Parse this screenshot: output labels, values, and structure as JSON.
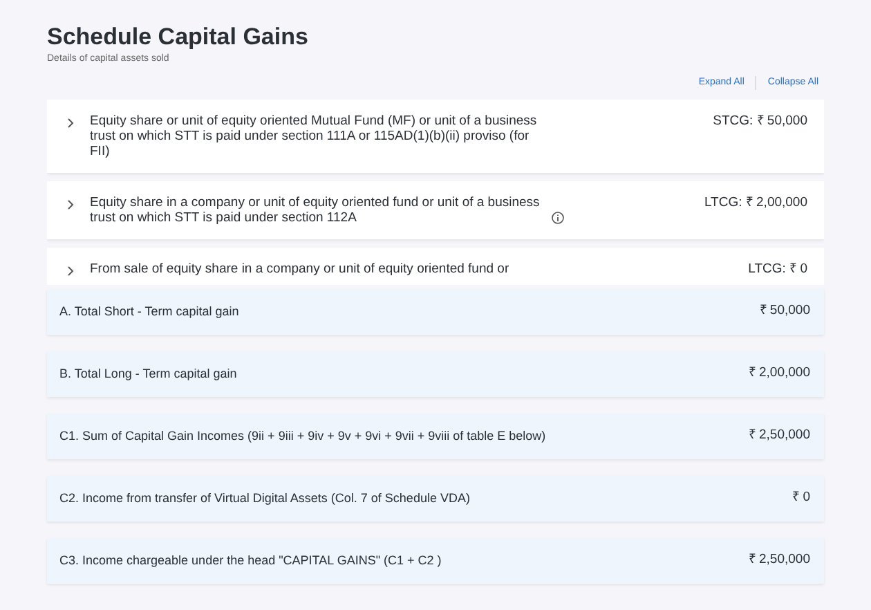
{
  "header": {
    "title": "Schedule Capital Gains",
    "subtitle": "Details of capital assets sold"
  },
  "actions": [
    "Expand All",
    "Collapse All"
  ],
  "sections": [
    {
      "expanded": false,
      "label": "Equity share or unit of equity oriented Mutual Fund (MF) or unit of a business trust on which STT is paid under section 111A or 115AD(1)(b)(ii) proviso (for FII)",
      "info": false,
      "amount_label": "STCG:",
      "amount": "₹ 50,000"
    },
    {
      "expanded": false,
      "label": "Equity share in a company or unit of equity oriented fund or unit of a business trust on which STT is paid under section 112A",
      "info": true,
      "amount_label": "LTCG:",
      "amount": "₹ 2,00,000"
    },
    {
      "expanded": false,
      "label": "From sale of equity share in a company or unit of equity oriented fund or",
      "info": false,
      "amount_label": "LTCG:",
      "amount": "₹ 0"
    }
  ],
  "totals": [
    {
      "label": "A. Total Short - Term capital gain",
      "amount": "₹ 50,000"
    },
    {
      "label": "B. Total Long - Term capital gain",
      "amount": "₹ 2,00,000"
    },
    {
      "label": "C1. Sum of Capital Gain Incomes (9ii + 9iii + 9iv + 9v + 9vi + 9vii + 9viii of table E below)",
      "amount": "₹ 2,50,000"
    },
    {
      "label": "C2. Income from transfer of Virtual Digital Assets (Col. 7 of Schedule VDA)",
      "amount": "₹ 0"
    },
    {
      "label": "C3. Income chargeable under the head \"CAPITAL GAINS\" (C1 + C2 )",
      "amount": "₹ 2,50,000"
    }
  ]
}
